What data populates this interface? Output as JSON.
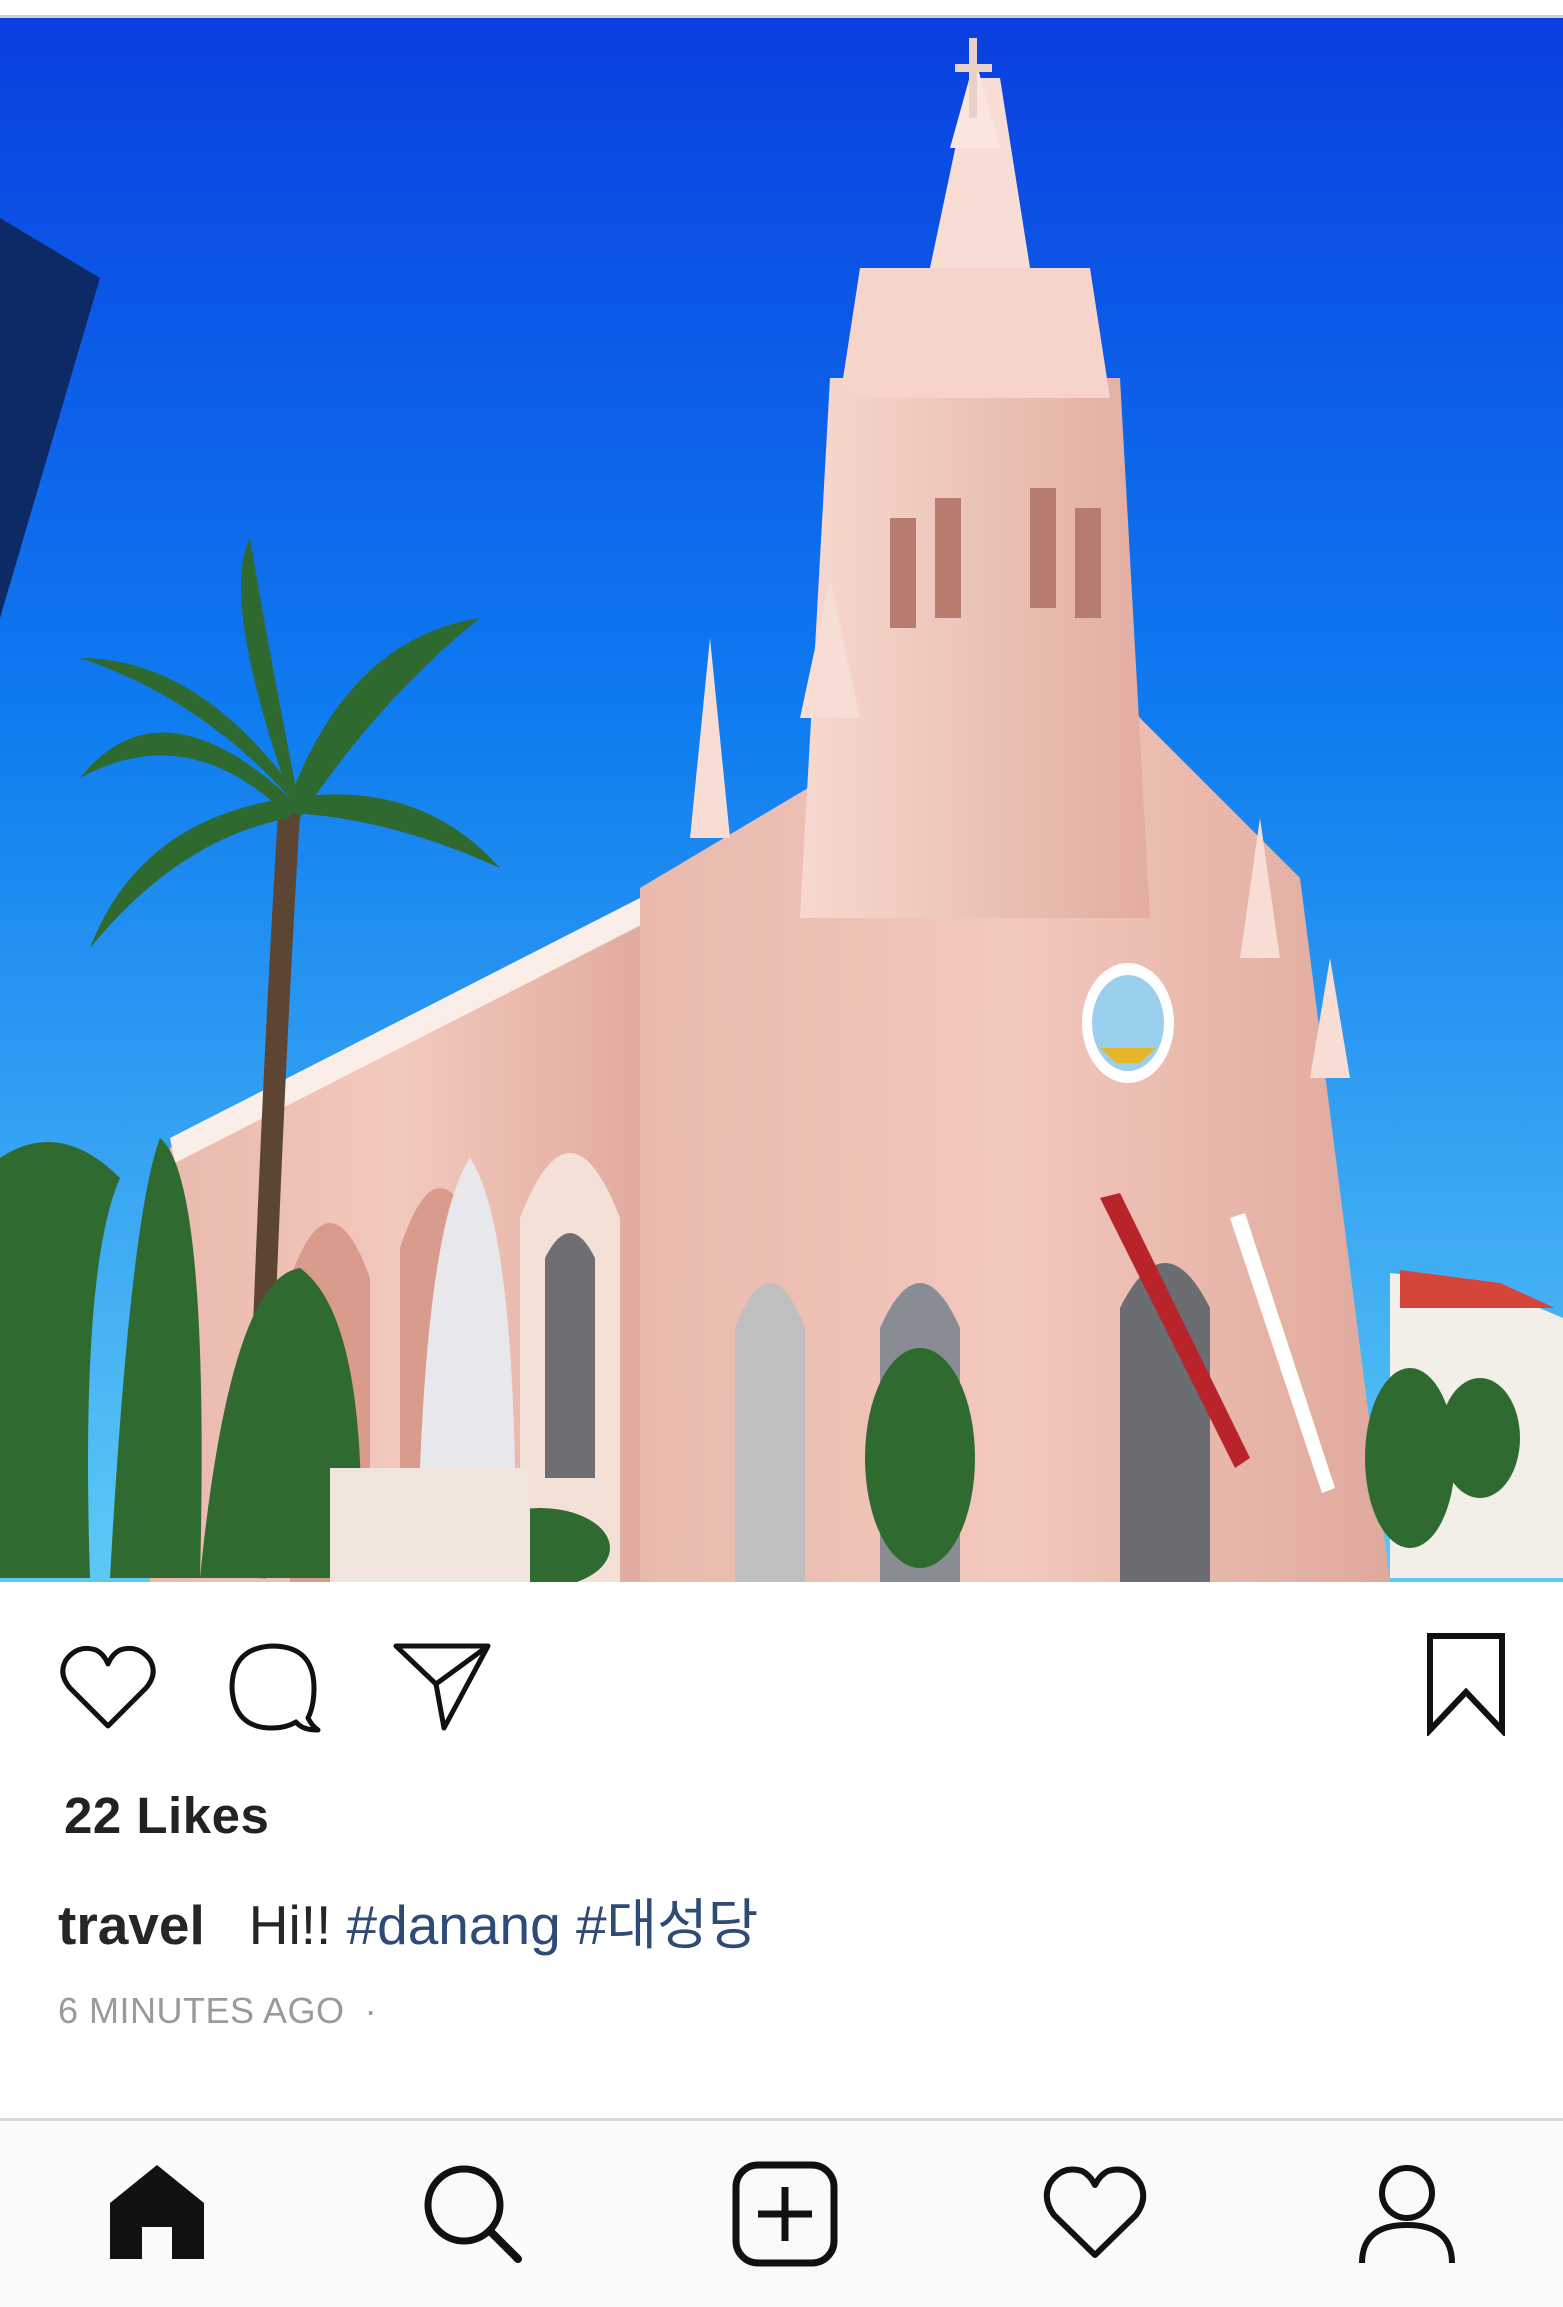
{
  "post": {
    "likes_label": "22 Likes",
    "username": "travel",
    "caption_text": "Hi!!",
    "hashtags": [
      "#danang",
      "#대성당"
    ],
    "timestamp": "6 MINUTES AGO",
    "timestamp_separator": "·"
  },
  "actions": {
    "like_icon": "heart-outline-icon",
    "comment_icon": "comment-bubble-icon",
    "share_icon": "paper-plane-icon",
    "save_icon": "bookmark-icon"
  },
  "bottom_nav": {
    "items": [
      "home-icon",
      "search-icon",
      "add-post-icon",
      "activity-heart-icon",
      "profile-icon"
    ]
  },
  "colors": {
    "hashtag": "#2e4a76",
    "text": "#262626",
    "muted": "#9a9a9a",
    "sky": "#0c6ef2"
  }
}
